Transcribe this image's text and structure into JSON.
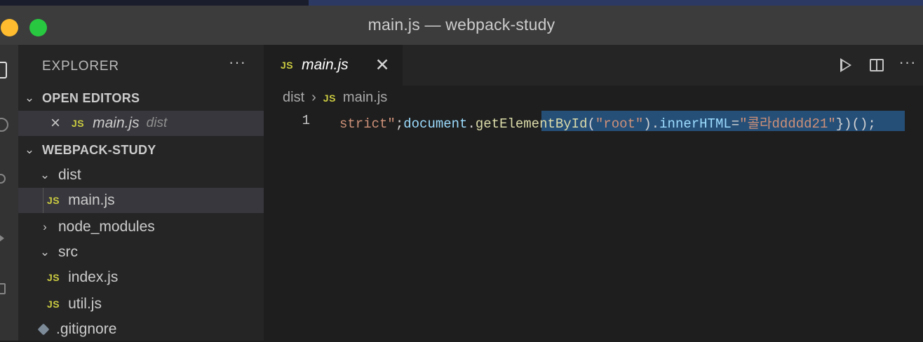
{
  "window": {
    "title": "main.js — webpack-study"
  },
  "sidebar": {
    "header": "EXPLORER",
    "more_label": "···",
    "open_editors": {
      "title": "OPEN EDITORS",
      "items": [
        {
          "badge": "JS",
          "name": "main.js",
          "description": "dist"
        }
      ]
    },
    "workspace": {
      "title": "WEBPACK-STUDY",
      "tree": [
        {
          "name": "dist",
          "type": "folder",
          "expanded": true
        },
        {
          "name": "main.js",
          "type": "file",
          "badge": "JS",
          "selected": true
        },
        {
          "name": "node_modules",
          "type": "folder",
          "expanded": false
        },
        {
          "name": "src",
          "type": "folder",
          "expanded": true
        },
        {
          "name": "index.js",
          "type": "file",
          "badge": "JS"
        },
        {
          "name": "util.js",
          "type": "file",
          "badge": "JS"
        },
        {
          "name": ".gitignore",
          "type": "file",
          "icon": "git-icon"
        }
      ]
    }
  },
  "editor": {
    "tab": {
      "badge": "JS",
      "label": "main.js",
      "close": "✕"
    },
    "breadcrumb": {
      "folder": "dist",
      "separator": "›",
      "badge": "JS",
      "file": "main.js"
    },
    "line_number": "1",
    "code_tokens": {
      "t1": "strict\"",
      "t2": ";",
      "t3": "document",
      "t4": ".",
      "t5": "getElementById",
      "t6": "(",
      "t7": "\"root\"",
      "t8": ").",
      "t9": "innerHTML",
      "t10": "=",
      "t11": "\"콜라ddddd21\"",
      "t12": "})();"
    },
    "actions": [
      "run-icon",
      "split-editor-icon",
      "more-actions-icon"
    ],
    "more_label": "···"
  },
  "colors": {
    "titlebar": "#3c3c3c",
    "sidebar": "#252526",
    "editor_bg": "#1e1e1e",
    "selection": "#264f78",
    "js_badge": "#cbcb41"
  }
}
